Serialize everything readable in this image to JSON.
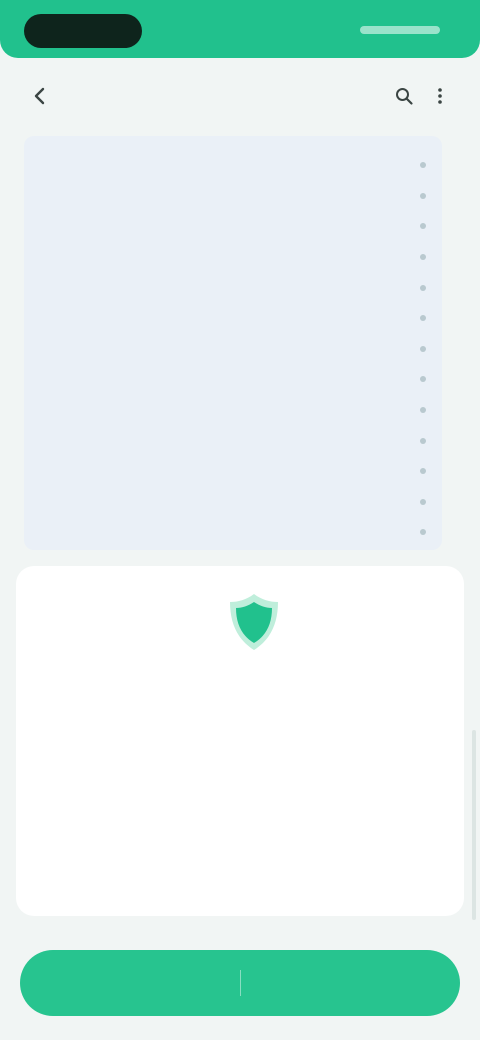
{
  "colors": {
    "accent": "#21c18d",
    "panel": "#eaf0f7",
    "card": "#ffffff",
    "background": "#f1f5f4"
  },
  "header": {
    "title": "",
    "back_icon": "back-arrow-icon",
    "icon_1": "search-icon",
    "icon_2": "more-icon"
  },
  "list": {
    "items": [
      {
        "label": ""
      },
      {
        "label": ""
      },
      {
        "label": ""
      },
      {
        "label": ""
      },
      {
        "label": ""
      },
      {
        "label": ""
      },
      {
        "label": ""
      },
      {
        "label": ""
      },
      {
        "label": ""
      },
      {
        "label": ""
      },
      {
        "label": ""
      },
      {
        "label": ""
      },
      {
        "label": ""
      }
    ]
  },
  "card": {
    "icon": "shield-icon",
    "title": "",
    "body": "",
    "link": ""
  },
  "bottom_bar": {
    "left_label": "",
    "right_label": ""
  }
}
